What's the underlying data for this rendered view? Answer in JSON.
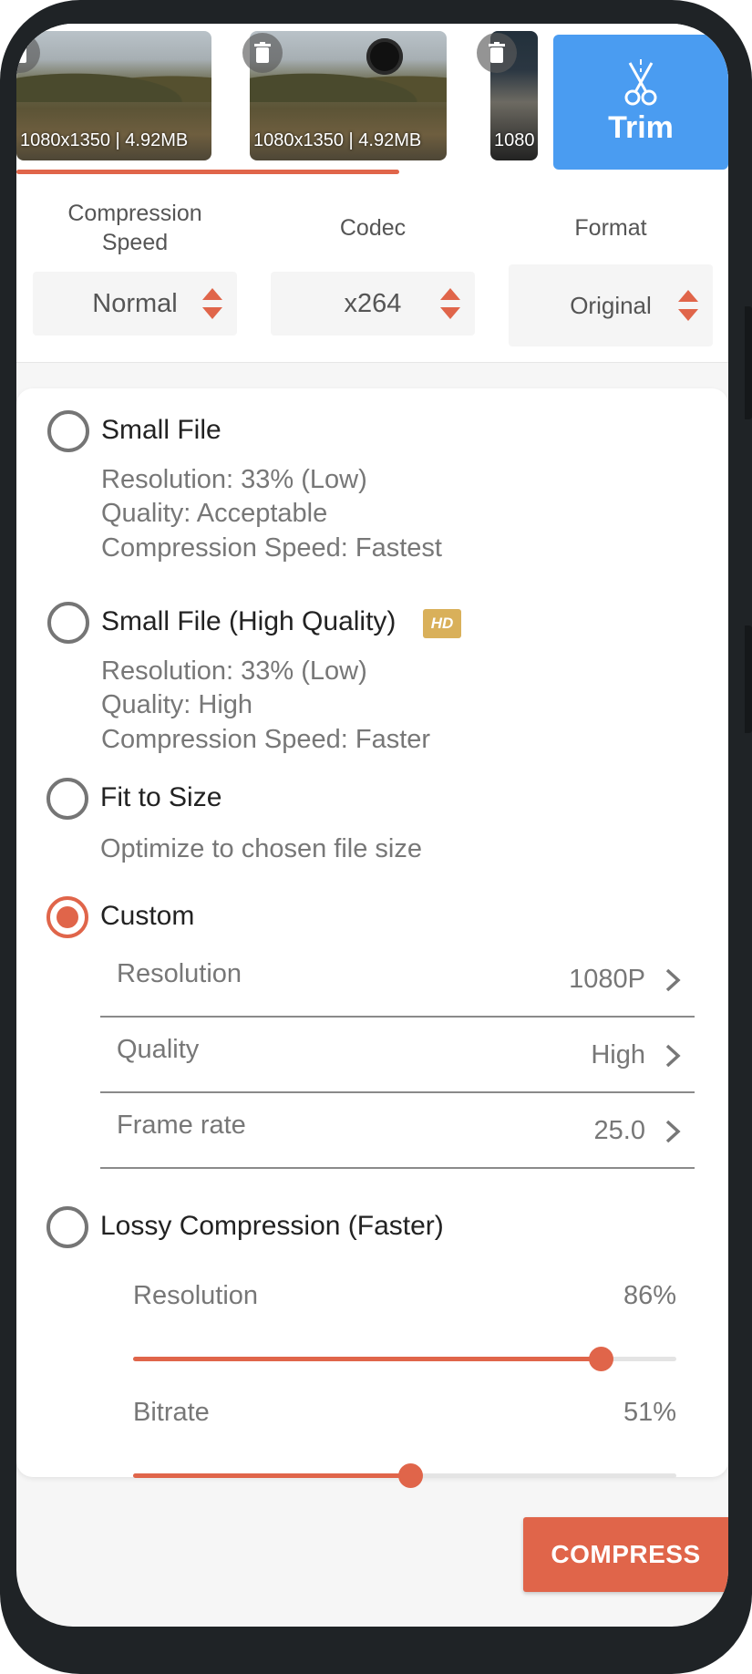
{
  "thumbnails": [
    {
      "label": "1080x1350 | 4.92MB"
    },
    {
      "label": "1080x1350 | 4.92MB"
    },
    {
      "label": "1080"
    }
  ],
  "trim_button": {
    "label": "Trim",
    "icon": "scissors-icon"
  },
  "selectors": {
    "compression_speed": {
      "title": "Compression Speed",
      "value": "Normal"
    },
    "codec": {
      "title": "Codec",
      "value": "x264"
    },
    "format": {
      "title": "Format",
      "value": "Original"
    }
  },
  "options": {
    "small_file": {
      "title": "Small File",
      "lines": [
        "Resolution: 33% (Low)",
        "Quality: Acceptable",
        "Compression Speed: Fastest"
      ],
      "selected": false
    },
    "small_file_hq": {
      "title": "Small File (High Quality)",
      "badge": "HD",
      "lines": [
        "Resolution: 33% (Low)",
        "Quality: High",
        "Compression Speed: Faster"
      ],
      "selected": false
    },
    "fit_to_size": {
      "title": "Fit to Size",
      "desc": "Optimize to chosen file size",
      "selected": false
    },
    "custom": {
      "title": "Custom",
      "selected": true,
      "rows": [
        {
          "key": "Resolution",
          "value": "1080P"
        },
        {
          "key": "Quality",
          "value": "High"
        },
        {
          "key": "Frame rate",
          "value": "25.0"
        }
      ]
    },
    "lossy": {
      "title": "Lossy Compression (Faster)",
      "selected": false,
      "sliders": [
        {
          "label": "Resolution",
          "value_text": "86%",
          "fraction": 0.86
        },
        {
          "label": "Bitrate",
          "value_text": "51%",
          "fraction": 0.51
        }
      ]
    }
  },
  "compress_button": {
    "label": "COMPRESS"
  },
  "colors": {
    "accent": "#e0654a",
    "trim_blue": "#4a9cf1",
    "hd_gold": "#d9b05a"
  }
}
